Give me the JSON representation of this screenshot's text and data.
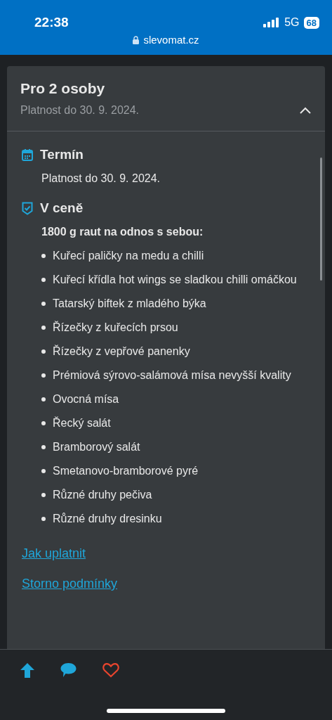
{
  "status_bar": {
    "time": "22:38",
    "network": "5G",
    "battery": "68",
    "url": "slevomat.cz"
  },
  "offer": {
    "title": "Pro 2 osoby",
    "subtitle": "Platnost do 30. 9. 2024.",
    "expanded": true
  },
  "sections": [
    {
      "kind": "calendar",
      "heading": "Termín",
      "text": "Platnost do 30. 9. 2024."
    },
    {
      "kind": "included",
      "heading": "V ceně",
      "lead": "1800 g raut na odnos s sebou:",
      "items": [
        "Kuřecí paličky na medu a chilli",
        "Kuřecí křídla hot wings se sladkou chilli omáčkou",
        "Tatarský biftek z mladého býka",
        "Řízečky z kuřecích prsou",
        "Řízečky z vepřové panenky",
        "Prémiová sýrovo-salámová mísa nevyšší kvality",
        "Ovocná mísa",
        "Řecký salát",
        "Bramborový salát",
        "Smetanovo-bramborové pyré",
        "Různé druhy pečiva",
        "Různé druhy dresinku"
      ]
    }
  ],
  "links": [
    "Jak uplatnit",
    "Storno podmínky"
  ],
  "bottom_bar": [
    {
      "kind": "up"
    },
    {
      "kind": "chat"
    },
    {
      "kind": "heart"
    }
  ]
}
